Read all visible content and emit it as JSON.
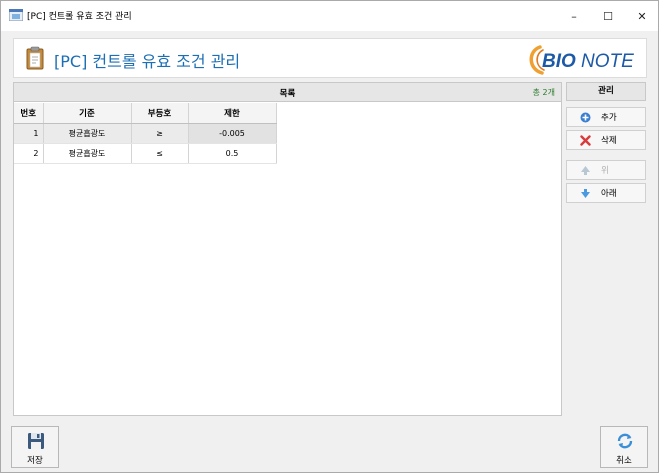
{
  "window": {
    "title": "[PC] 컨트롤 유효 조건 관리",
    "controls": {
      "minimize": "–",
      "maximize": "☐",
      "close": "✕"
    }
  },
  "banner": {
    "heading": "[PC] 컨트롤 유효 조건 관리",
    "logo_text": "BIONOTE",
    "logo_prefix": "BIO",
    "logo_suffix": "NOTE",
    "logo_color": "#1c5aa8"
  },
  "list": {
    "title": "목록",
    "count": "총 2개",
    "columns": [
      "번호",
      "기준",
      "부등호",
      "제한"
    ],
    "rows": [
      {
        "no": "1",
        "criterion": "평균흡광도",
        "operator": "≥",
        "limit": "-0.005"
      },
      {
        "no": "2",
        "criterion": "평균흡광도",
        "operator": "≤",
        "limit": "0.5"
      }
    ]
  },
  "manage": {
    "title": "관리",
    "add": "추가",
    "delete": "삭제",
    "up": "위",
    "down": "아래"
  },
  "footer": {
    "save": "저장",
    "cancel": "취소"
  },
  "colors": {
    "accent": "#1c6fb5",
    "count": "#2a7a2a",
    "delete_icon": "#d83b3b"
  }
}
